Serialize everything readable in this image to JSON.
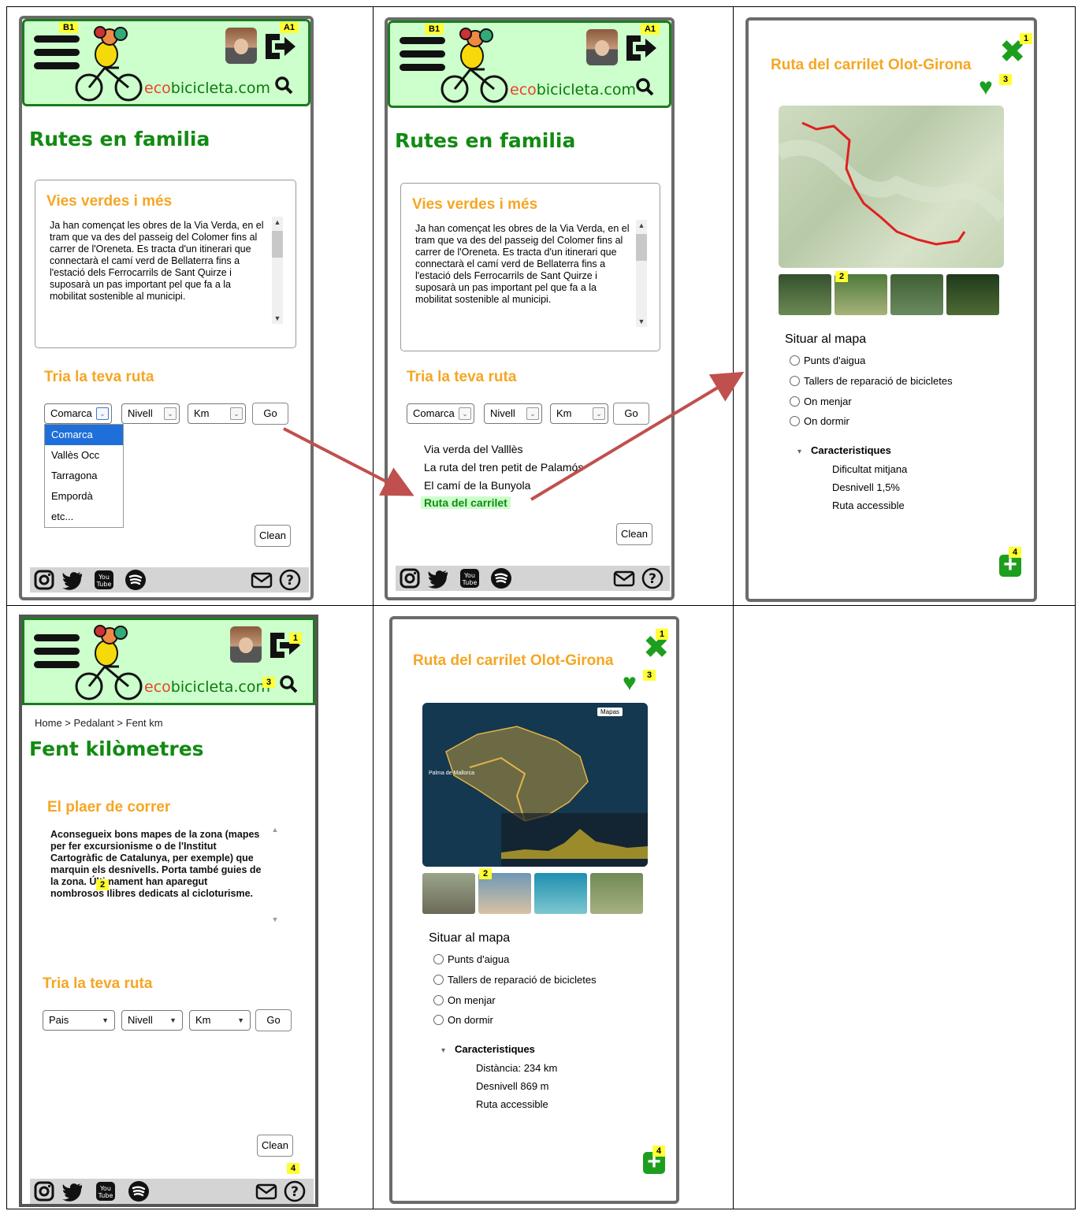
{
  "brand": {
    "prefix": "eco",
    "main": "bicicleta.com"
  },
  "tags": {
    "b1": "B1",
    "a1": "A1",
    "n1": "1",
    "n2": "2",
    "n3": "3",
    "n4": "4"
  },
  "screen1": {
    "title": "Rutes en familia",
    "box_title": "Vies verdes i més",
    "box_text": "Ja han començat les obres de la Via Verda, en el tram que va des del passeig del Colomer fins al carrer de l'Oreneta. Es tracta d'un itinerari que connectarà el camí verd de Bellaterra fins a l'estació dels Ferrocarrils de Sant Quirze i suposarà un pas important pel que fa a la mobilitat sostenible al municipi.",
    "route_title": "Tria la teva ruta",
    "select_comarca": "Comarca",
    "select_nivell": "Nivell",
    "select_km": "Km",
    "go": "Go",
    "dropdown": [
      "Comarca",
      "Vallès Occ",
      "Tarragona",
      "Empordà",
      "etc..."
    ],
    "clean": "Clean"
  },
  "screen2": {
    "title": "Rutes en familia",
    "box_title": "Vies verdes i més",
    "box_text": "Ja han començat les obres de la Via Verda, en el tram que va des del passeig del Colomer fins al carrer de l'Oreneta. Es tracta d'un itinerari que connectarà el camí verd de Bellaterra fins a l'estació dels Ferrocarrils de Sant Quirze i suposarà un pas important pel que fa a la mobilitat sostenible al municipi.",
    "route_title": "Tria la teva ruta",
    "select_comarca": "Comarca",
    "select_nivell": "Nivell",
    "select_km": "Km",
    "go": "Go",
    "routes": [
      "Via verda del Valllès",
      "La ruta del tren petit de Palamós",
      "El camí de la Bunyola",
      "Ruta del carrilet"
    ],
    "clean": "Clean"
  },
  "screen3": {
    "title": "Ruta del carrilet Olot-Girona",
    "situar": "Situar al mapa",
    "options": [
      "Punts d'aigua",
      "Tallers de reparació de bicicletes",
      "On menjar",
      "On dormir"
    ],
    "car_head": "Caracteristiques",
    "car_items": [
      "Dificultat mitjana",
      "Desnivell 1,5%",
      "Ruta accessible"
    ]
  },
  "screen4": {
    "breadcrumb": "Home > Pedalant > Fent km",
    "title": "Fent kilòmetres",
    "box_title": "El plaer de correr",
    "box_text": "Aconsegueix bons mapes de la zona (mapes per fer excursionisme o de l'Institut Cartogràfic de Catalunya, per exemple) que marquin els desnivells. Porta també guies de la zona. Últimament han aparegut nombrosos llibres dedicats al cicloturisme.",
    "route_title": "Tria la teva ruta",
    "select_pais": "Pais",
    "select_nivell": "Nivell",
    "select_km": "Km",
    "go": "Go",
    "clean": "Clean"
  },
  "screen5": {
    "title": "Ruta del carrilet Olot-Girona",
    "situar": "Situar al mapa",
    "options": [
      "Punts d'aigua",
      "Tallers de reparació de bicicletes",
      "On menjar",
      "On dormir"
    ],
    "car_head": "Caracteristiques",
    "car_items": [
      "Distància: 234 km",
      "Desnivell 869 m",
      "Ruta accessible"
    ],
    "map_button": "Mapas",
    "map_label": "Palma de Mallorca"
  },
  "icons": {
    "menu": "hamburger-menu-icon",
    "logo": "cyclist-logo",
    "avatar": "user-avatar",
    "logout": "logout-icon",
    "search": "search-icon",
    "instagram": "instagram-icon",
    "twitter": "twitter-icon",
    "youtube": "youtube-icon",
    "spotify": "spotify-icon",
    "mail": "mail-icon",
    "help": "help-icon",
    "close": "close-icon",
    "favorite": "heart-icon",
    "add": "plus-icon"
  },
  "colors": {
    "header_bg": "#ccffcc",
    "header_border": "#1e7a1e",
    "title_green": "#138a13",
    "orange": "#f5a623",
    "arrow": "#c0504d",
    "badge": "#ffff33"
  }
}
